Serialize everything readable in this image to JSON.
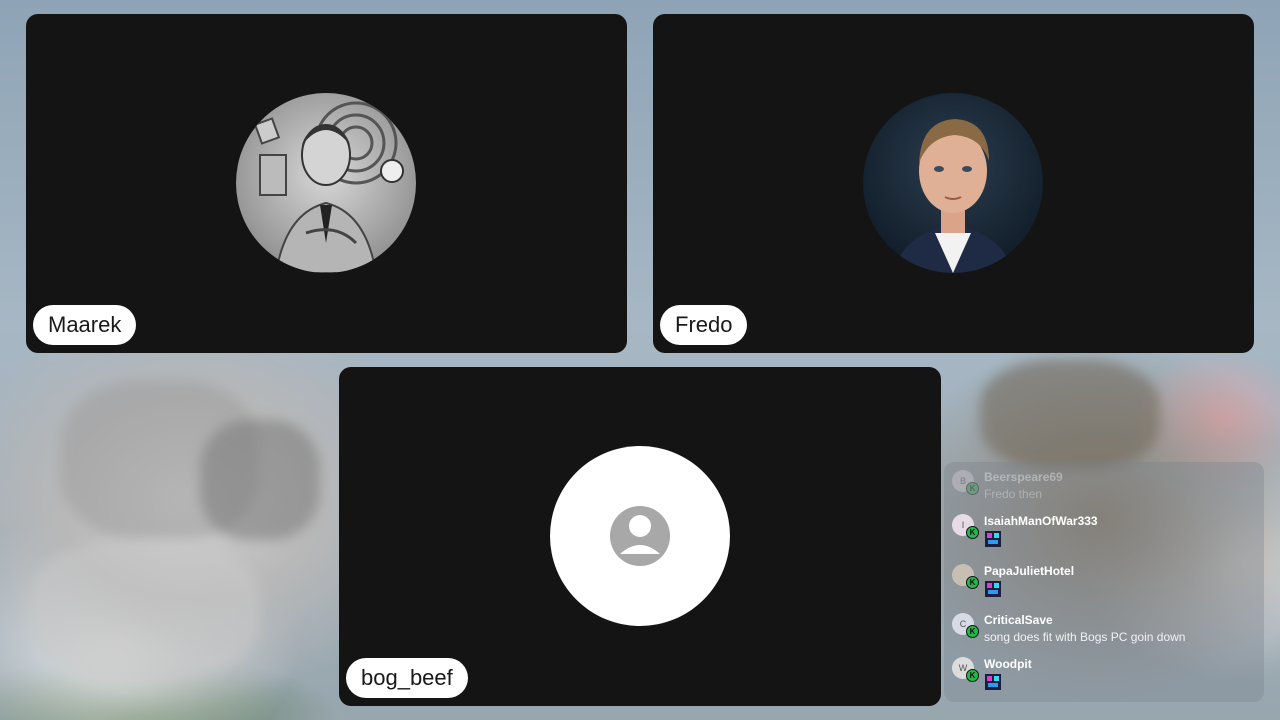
{
  "participants": [
    {
      "name": "Maarek"
    },
    {
      "name": "Fredo"
    },
    {
      "name": "bog_beef"
    }
  ],
  "chat": {
    "messages": [
      {
        "initial": "B",
        "user": "Beerspeare69",
        "text": "Fredo then"
      },
      {
        "initial": "I",
        "user": "IsaiahManOfWar333",
        "emote": "emote-icon"
      },
      {
        "initial": "",
        "user": "PapaJulietHotel",
        "emote": "emote-icon"
      },
      {
        "initial": "C",
        "user": "CriticalSave",
        "text": "song does fit with Bogs PC goin down"
      },
      {
        "initial": "W",
        "user": "Woodpit",
        "emote": "emote-icon"
      }
    ]
  },
  "colors": {
    "tile_background": "#141414",
    "badge_green": "#1fb84a",
    "name_pill": "#ffffff"
  }
}
